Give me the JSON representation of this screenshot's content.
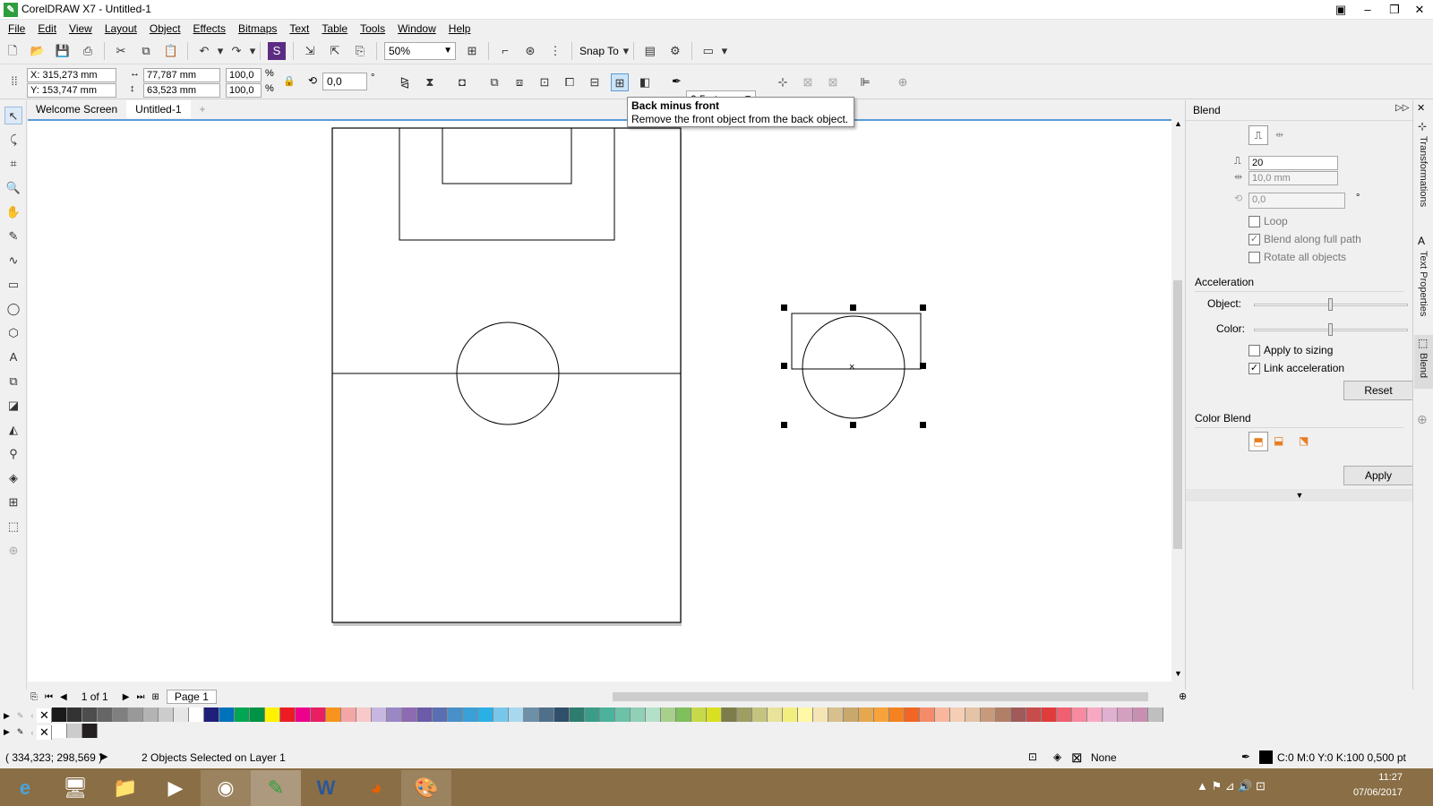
{
  "window": {
    "title": "CorelDRAW X7 - Untitled-1"
  },
  "menu": [
    "File",
    "Edit",
    "View",
    "Layout",
    "Object",
    "Effects",
    "Bitmaps",
    "Text",
    "Table",
    "Tools",
    "Window",
    "Help"
  ],
  "toolbar": {
    "zoom": "50%",
    "snap_label": "Snap To"
  },
  "propbar": {
    "x": "X: 315,273 mm",
    "y": "Y: 153,747 mm",
    "w": "77,787 mm",
    "h": "63,523 mm",
    "sx": "100,0",
    "sy": "100,0",
    "pct1": "%",
    "pct2": "%",
    "angle": "0,0",
    "deg": "°",
    "outline": "0,5 pt"
  },
  "tabs": {
    "welcome": "Welcome Screen",
    "doc": "Untitled-1"
  },
  "tooltip": {
    "title": "Back minus front",
    "text": "Remove the front object from the back object."
  },
  "pager": {
    "count": "1 of 1",
    "page": "Page 1"
  },
  "status": {
    "coords": "( 334,323; 298,569 )",
    "selection": "2 Objects Selected on Layer 1",
    "fill": "None",
    "outline": "C:0 M:0 Y:0 K:100  0,500 pt"
  },
  "clock": {
    "time": "11:27",
    "date": "07/06/2017"
  },
  "docker": {
    "title": "Blend",
    "steps": "20",
    "spacing": "10,0 mm",
    "rotation": "0,0",
    "deg": "°",
    "loop": "Loop",
    "blend_path": "Blend along full path",
    "rotate_all": "Rotate all objects",
    "accel_title": "Acceleration",
    "object_label": "Object:",
    "color_label": "Color:",
    "apply_sizing": "Apply to sizing",
    "link_accel": "Link acceleration",
    "reset": "Reset",
    "color_blend": "Color Blend",
    "apply": "Apply",
    "check_blend_path": "✓",
    "check_link_accel": "✓",
    "object_accel": 0.5,
    "color_accel": 0.5
  },
  "dock_tabs": [
    "Transformations",
    "Text Properties",
    "Blend"
  ],
  "palette": [
    "#1a1a1a",
    "#333333",
    "#4d4d4d",
    "#666666",
    "#808080",
    "#999999",
    "#b3b3b3",
    "#cccccc",
    "#e6e6e6",
    "#ffffff",
    "#1f1f7a",
    "#0072bc",
    "#00a651",
    "#009245",
    "#fff200",
    "#ed1c24",
    "#ec008c",
    "#e91e63",
    "#f7941d",
    "#f4a6a6",
    "#f9c9c9",
    "#c7b7e0",
    "#9a88c5",
    "#8c6bb1",
    "#6b5ba8",
    "#5a6fb3",
    "#4a90c8",
    "#3aa0d8",
    "#2bb0e6",
    "#78c6ea",
    "#a7d8f0",
    "#6e8fa8",
    "#4f6f8a",
    "#2f4f6a",
    "#2d7c6e",
    "#3a9d8a",
    "#4bb39b",
    "#6cc1a8",
    "#8fd0b7",
    "#b4e0c9",
    "#a8d08d",
    "#7fbf5c",
    "#c5d94a",
    "#d9e021",
    "#7d7d4c",
    "#9e9e63",
    "#c4c47f",
    "#e8e29a",
    "#f3ef7e",
    "#fff8a6",
    "#f5e5b5",
    "#d8c08e",
    "#c9a86d",
    "#e6a84e",
    "#f7a23b",
    "#f58220",
    "#f26522",
    "#f48c6b",
    "#f9b69d",
    "#f4cfb5",
    "#e5c3a6",
    "#c79a7c",
    "#b17f66",
    "#a05a5a",
    "#c94c4c",
    "#e03c3c",
    "#f06070",
    "#f58aa0",
    "#f7a9c4",
    "#e0b0d0",
    "#d4a0c0",
    "#c890b0",
    "#bfbfbf"
  ],
  "palette2": [
    "#ffffff",
    "#cccccc",
    "#231f20"
  ]
}
